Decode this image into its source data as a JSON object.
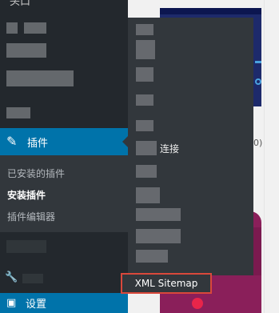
{
  "sidebar": {
    "top_partial_label": "头口",
    "plugins_label": "插件",
    "plugins_submenu": [
      {
        "label": "已安装的插件",
        "current": false
      },
      {
        "label": "安装插件",
        "current": true
      },
      {
        "label": "插件编辑器",
        "current": false
      }
    ],
    "settings_label": "设置",
    "settings_icon": "settings-sliders-icon",
    "plugins_icon": "plug-icon",
    "tools_icon": "wrench-icon"
  },
  "flyout": {
    "connect_label": "连接",
    "highlighted_item": "XML Sitemap"
  },
  "content": {
    "row_text": "0)"
  },
  "colors": {
    "sidebar_bg": "#23282d",
    "submenu_bg": "#32373c",
    "active_blue": "#0073aa",
    "highlight_red": "#d9483b"
  }
}
